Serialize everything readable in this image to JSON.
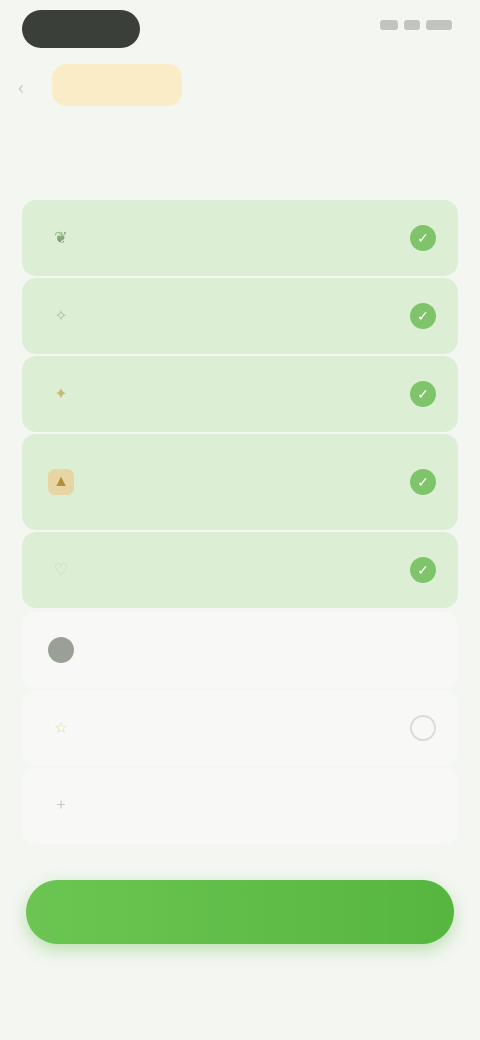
{
  "status_bar": {
    "time": "",
    "indicators": [
      "signal",
      "wifi",
      "battery"
    ]
  },
  "header": {
    "back_icon": "chevron-left-icon",
    "badge": ""
  },
  "question": "",
  "options": [
    {
      "label": "",
      "icon": "leaf-icon",
      "selected": true
    },
    {
      "label": "",
      "icon": "sparkle-icon",
      "selected": true
    },
    {
      "label": "",
      "icon": "bulb-icon",
      "selected": true
    },
    {
      "label": "",
      "icon": "trophy-icon",
      "selected": true
    },
    {
      "label": "",
      "icon": "heart-icon",
      "selected": true
    },
    {
      "label": "",
      "icon": "circle-icon",
      "selected": false
    },
    {
      "label": "",
      "icon": "star-icon",
      "selected": false
    },
    {
      "label": "",
      "icon": "plus-icon",
      "selected": false
    }
  ],
  "continue_button": "",
  "colors": {
    "accent": "#63bd4b",
    "selected_bg": "#dceed4",
    "badge_bg": "#fbecc8"
  }
}
